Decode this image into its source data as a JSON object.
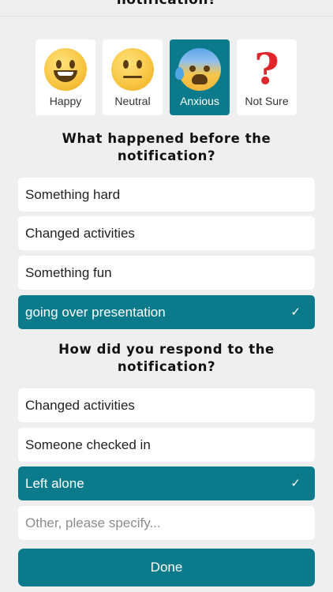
{
  "top_cut_heading": "notification?",
  "moods": [
    {
      "label": "Happy",
      "icon": "grinning-face-icon",
      "selected": false
    },
    {
      "label": "Neutral",
      "icon": "neutral-face-icon",
      "selected": false
    },
    {
      "label": "Anxious",
      "icon": "anxious-face-with-sweat-icon",
      "selected": true
    },
    {
      "label": "Not Sure",
      "icon": "red-question-mark-icon",
      "selected": false
    }
  ],
  "before_section": {
    "question_line1": "What happened before the",
    "question_line2": "notification?",
    "options": [
      {
        "label": "Something hard",
        "selected": false
      },
      {
        "label": "Changed activities",
        "selected": false
      },
      {
        "label": "Something fun",
        "selected": false
      },
      {
        "label": "going over presentation",
        "selected": true
      }
    ]
  },
  "response_section": {
    "question_line1": "How did you respond to the",
    "question_line2": "notification?",
    "options": [
      {
        "label": "Changed activities",
        "selected": false
      },
      {
        "label": "Someone checked in",
        "selected": false
      },
      {
        "label": "Left alone",
        "selected": true
      }
    ],
    "other_placeholder": "Other, please specify..."
  },
  "check_glyph": "✓",
  "done_label": "Done",
  "colors": {
    "accent": "#0b7b8c",
    "background": "#efefef",
    "card": "#ffffff"
  }
}
